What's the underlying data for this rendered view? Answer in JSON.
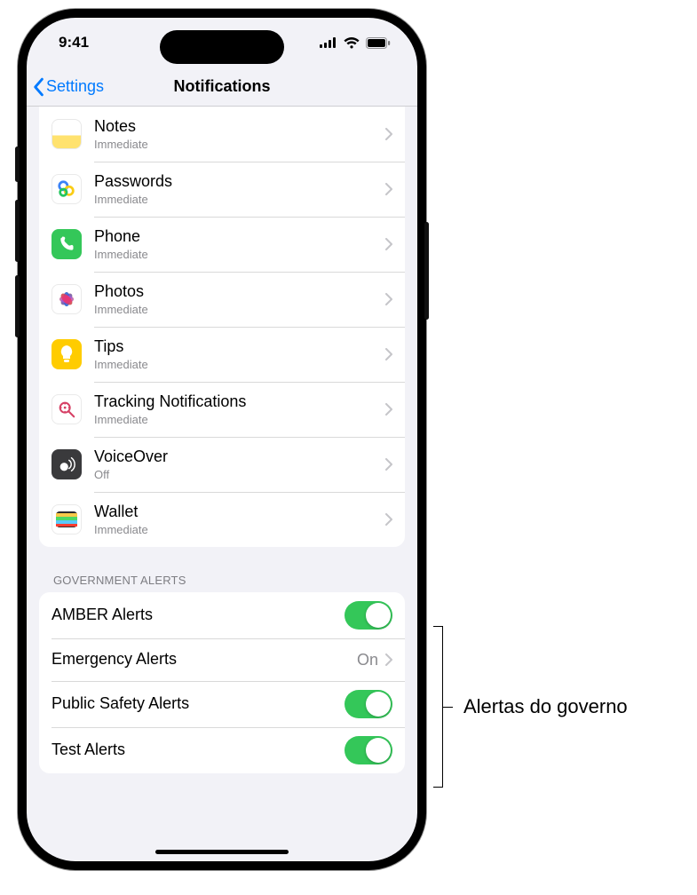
{
  "status": {
    "time": "9:41"
  },
  "nav": {
    "back_label": "Settings",
    "title": "Notifications"
  },
  "apps": [
    {
      "name": "Notes",
      "sub": "Immediate",
      "icon": "notes"
    },
    {
      "name": "Passwords",
      "sub": "Immediate",
      "icon": "passwords"
    },
    {
      "name": "Phone",
      "sub": "Immediate",
      "icon": "phone"
    },
    {
      "name": "Photos",
      "sub": "Immediate",
      "icon": "photos"
    },
    {
      "name": "Tips",
      "sub": "Immediate",
      "icon": "tips"
    },
    {
      "name": "Tracking Notifications",
      "sub": "Immediate",
      "icon": "tracking"
    },
    {
      "name": "VoiceOver",
      "sub": "Off",
      "icon": "voiceover"
    },
    {
      "name": "Wallet",
      "sub": "Immediate",
      "icon": "wallet"
    }
  ],
  "gov_section": {
    "header": "GOVERNMENT ALERTS"
  },
  "gov_alerts": [
    {
      "label": "AMBER Alerts",
      "type": "toggle",
      "on": true
    },
    {
      "label": "Emergency Alerts",
      "type": "drill",
      "value": "On"
    },
    {
      "label": "Public Safety Alerts",
      "type": "toggle",
      "on": true
    },
    {
      "label": "Test Alerts",
      "type": "toggle",
      "on": true
    }
  ],
  "callout": {
    "label": "Alertas do governo"
  }
}
